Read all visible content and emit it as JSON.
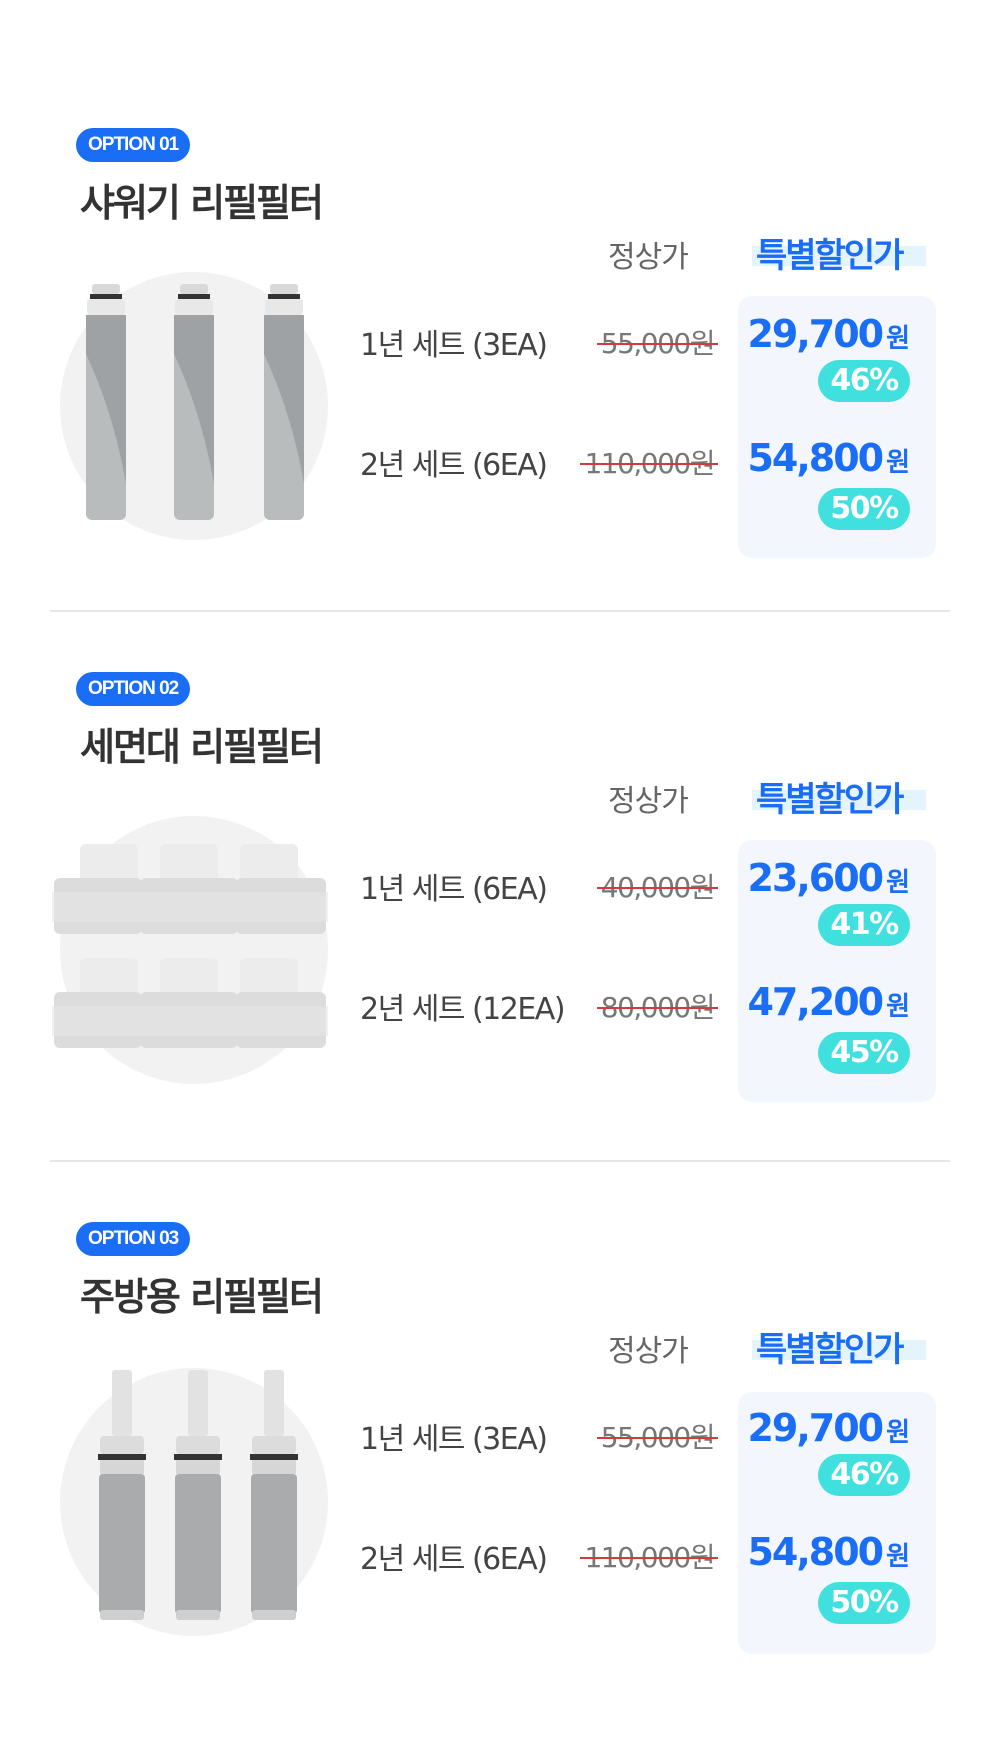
{
  "headers": {
    "regular": "정상가",
    "special": "특별할인가"
  },
  "sections": [
    {
      "badge": "OPTION 01",
      "title": "샤워기 리필필터",
      "rows": [
        {
          "label": "1년 세트 (3EA)",
          "original": "55,000원",
          "price": "29,700",
          "currency": "원",
          "discount": "46%"
        },
        {
          "label": "2년 세트 (6EA)",
          "original": "110,000원",
          "price": "54,800",
          "currency": "원",
          "discount": "50%"
        }
      ]
    },
    {
      "badge": "OPTION 02",
      "title": "세면대 리필필터",
      "rows": [
        {
          "label": "1년 세트 (6EA)",
          "original": "40,000원",
          "price": "23,600",
          "currency": "원",
          "discount": "41%"
        },
        {
          "label": "2년 세트 (12EA)",
          "original": "80,000원",
          "price": "47,200",
          "currency": "원",
          "discount": "45%"
        }
      ]
    },
    {
      "badge": "OPTION 03",
      "title": "주방용 리필필터",
      "rows": [
        {
          "label": "1년 세트 (3EA)",
          "original": "55,000원",
          "price": "29,700",
          "currency": "원",
          "discount": "46%"
        },
        {
          "label": "2년 세트 (6EA)",
          "original": "110,000원",
          "price": "54,800",
          "currency": "원",
          "discount": "50%"
        }
      ]
    }
  ],
  "colors": {
    "accent": "#1a6df5",
    "discount_badge": "#3fe0dd",
    "strike": "#d33a3a",
    "price_box": "#f3f7fd"
  }
}
